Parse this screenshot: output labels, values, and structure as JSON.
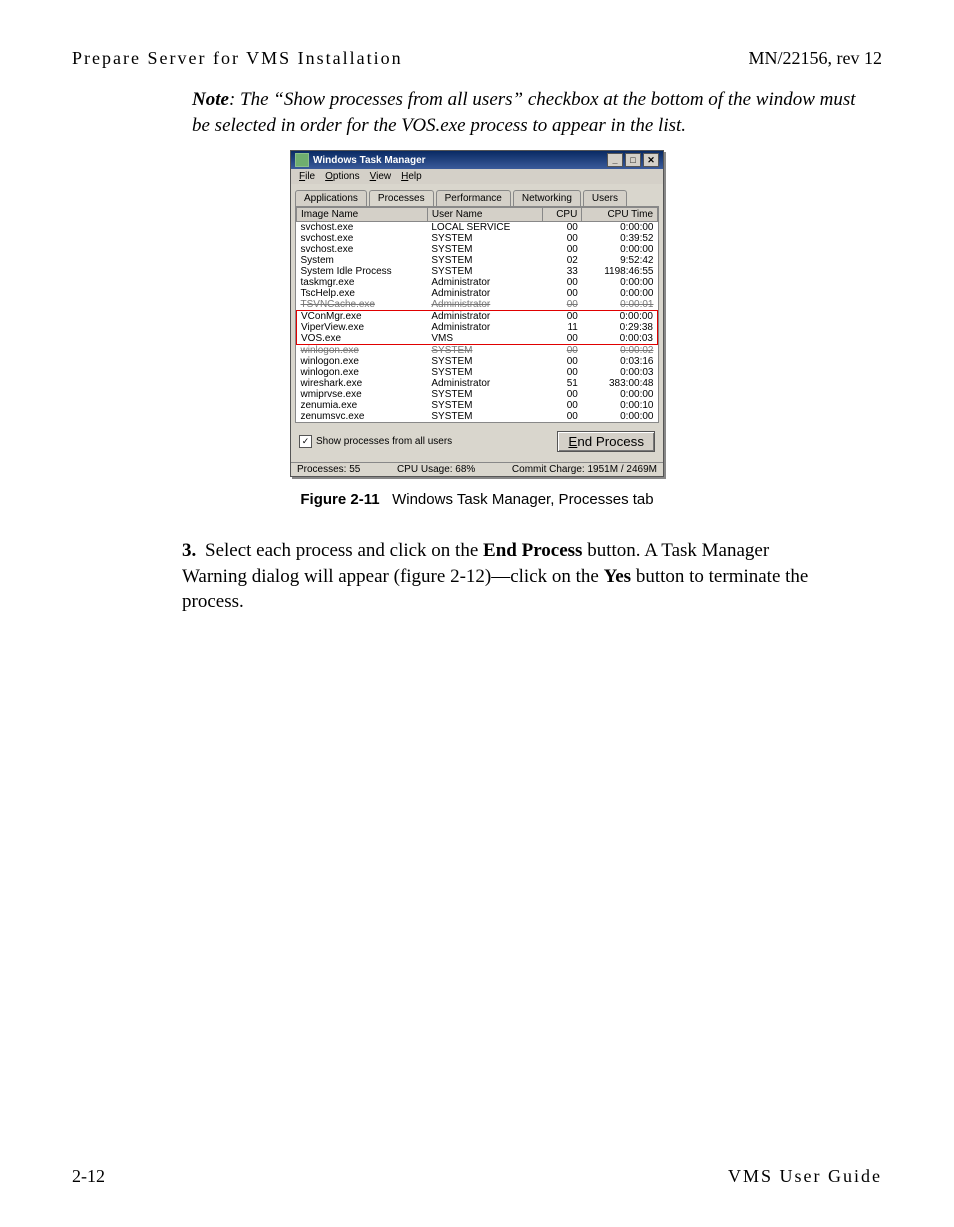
{
  "header": {
    "left": "Prepare Server for VMS Installation",
    "right": "MN/22156, rev 12"
  },
  "note": {
    "lead": "Note",
    "text": ": The “Show processes from all users” checkbox at the bottom of the window must be selected in order for the VOS.exe process to appear in the list."
  },
  "window": {
    "title": "Windows Task Manager",
    "min_icon": "_",
    "max_icon": "□",
    "close_icon": "✕",
    "menu": [
      "File",
      "Options",
      "View",
      "Help"
    ],
    "tabs": [
      "Applications",
      "Processes",
      "Performance",
      "Networking",
      "Users"
    ],
    "active_tab": 1,
    "columns": [
      "Image Name",
      "User Name",
      "CPU",
      "CPU Time"
    ],
    "rows": [
      {
        "image": "svchost.exe",
        "user": "LOCAL SERVICE",
        "cpu": "00",
        "time": "0:00:00"
      },
      {
        "image": "svchost.exe",
        "user": "SYSTEM",
        "cpu": "00",
        "time": "0:39:52"
      },
      {
        "image": "svchost.exe",
        "user": "SYSTEM",
        "cpu": "00",
        "time": "0:00:00"
      },
      {
        "image": "System",
        "user": "SYSTEM",
        "cpu": "02",
        "time": "9:52:42"
      },
      {
        "image": "System Idle Process",
        "user": "SYSTEM",
        "cpu": "33",
        "time": "1198:46:55"
      },
      {
        "image": "taskmgr.exe",
        "user": "Administrator",
        "cpu": "00",
        "time": "0:00:00"
      },
      {
        "image": "TscHelp.exe",
        "user": "Administrator",
        "cpu": "00",
        "time": "0:00:00"
      },
      {
        "image": "TSVNCache.exe",
        "user": "Administrator",
        "cpu": "00",
        "time": "0:00:01",
        "strike": true
      },
      {
        "image": "VConMgr.exe",
        "user": "Administrator",
        "cpu": "00",
        "time": "0:00:00",
        "hl": true
      },
      {
        "image": "ViperView.exe",
        "user": "Administrator",
        "cpu": "11",
        "time": "0:29:38",
        "hl": true
      },
      {
        "image": "VOS.exe",
        "user": "VMS",
        "cpu": "00",
        "time": "0:00:03",
        "hl": true
      },
      {
        "image": "winlogon.exe",
        "user": "SYSTEM",
        "cpu": "00",
        "time": "0:00:02",
        "strike": true
      },
      {
        "image": "winlogon.exe",
        "user": "SYSTEM",
        "cpu": "00",
        "time": "0:03:16"
      },
      {
        "image": "winlogon.exe",
        "user": "SYSTEM",
        "cpu": "00",
        "time": "0:00:03"
      },
      {
        "image": "wireshark.exe",
        "user": "Administrator",
        "cpu": "51",
        "time": "383:00:48"
      },
      {
        "image": "wmiprvse.exe",
        "user": "SYSTEM",
        "cpu": "00",
        "time": "0:00:00"
      },
      {
        "image": "zenumia.exe",
        "user": "SYSTEM",
        "cpu": "00",
        "time": "0:00:10"
      },
      {
        "image": "zenumsvc.exe",
        "user": "SYSTEM",
        "cpu": "00",
        "time": "0:00:00"
      }
    ],
    "show_all_label": "Show processes from all users",
    "show_all_checked": true,
    "end_process": "End Process",
    "status": {
      "procs": "Processes: 55",
      "cpu": "CPU Usage: 68%",
      "commit": "Commit Charge: 1951M / 2469M"
    }
  },
  "caption": {
    "figno": "Figure 2-11",
    "text": "Windows Task Manager, Processes tab"
  },
  "step": {
    "no": "3.",
    "text_a": " Select each process and click on the ",
    "b1": "End Process",
    "text_b": " button. A Task Manager Warning dialog will appear (figure 2-12)—click on the ",
    "b2": "Yes",
    "text_c": " button to terminate the process."
  },
  "footer": {
    "left": "2-12",
    "right": "VMS User Guide"
  }
}
